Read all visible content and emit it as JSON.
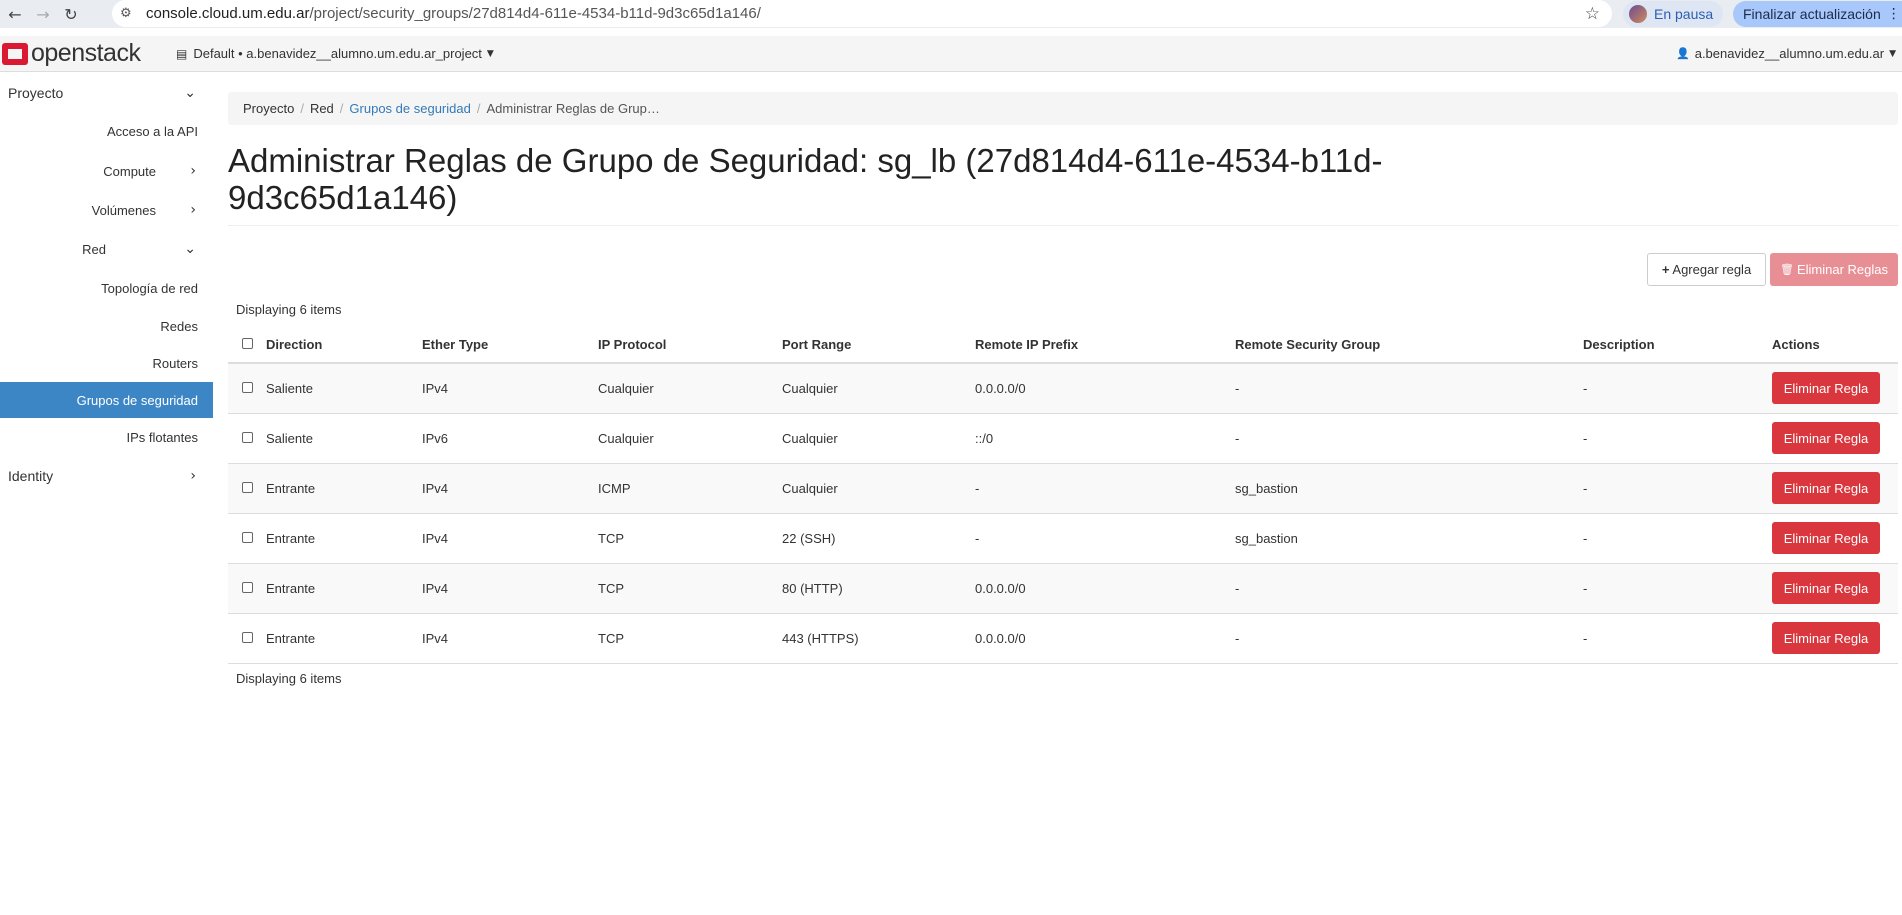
{
  "browser": {
    "url_host": "console.cloud.um.edu.ar",
    "url_path": "/project/security_groups/27d814d4-611e-4534-b11d-9d3c65d1a146/",
    "pause_label": "En pausa",
    "update_label": "Finalizar actualización"
  },
  "topnav": {
    "logo_text": "openstack",
    "project_label": "Default • a.benavidez__alumno.um.edu.ar_project",
    "user_label": "a.benavidez__alumno.um.edu.ar"
  },
  "sidebar": {
    "items": [
      {
        "label": "Proyecto"
      },
      {
        "label": "Acceso a la API"
      },
      {
        "label": "Compute"
      },
      {
        "label": "Volúmenes"
      },
      {
        "label": "Red"
      },
      {
        "label": "Topología de red"
      },
      {
        "label": "Redes"
      },
      {
        "label": "Routers"
      },
      {
        "label": "Grupos de seguridad"
      },
      {
        "label": "IPs flotantes"
      },
      {
        "label": "Identity"
      }
    ]
  },
  "breadcrumb": [
    "Proyecto",
    "Red",
    "Grupos de seguridad",
    "Administrar Reglas de Grup…"
  ],
  "page": {
    "title": "Administrar Reglas de Grupo de Seguridad: sg_lb (27d814d4-611e-4534-b11d-9d3c65d1a146)",
    "add_button": "Agregar regla",
    "delete_all_button": "Eliminar Reglas",
    "count_label": "Displaying 6 items"
  },
  "table": {
    "columns": [
      "Direction",
      "Ether Type",
      "IP Protocol",
      "Port Range",
      "Remote IP Prefix",
      "Remote Security Group",
      "Description",
      "Actions"
    ],
    "action_label": "Eliminar Regla",
    "rows": [
      [
        "Saliente",
        "IPv4",
        "Cualquier",
        "Cualquier",
        "0.0.0.0/0",
        "-",
        "-"
      ],
      [
        "Saliente",
        "IPv6",
        "Cualquier",
        "Cualquier",
        "::/0",
        "-",
        "-"
      ],
      [
        "Entrante",
        "IPv4",
        "ICMP",
        "Cualquier",
        "-",
        "sg_bastion",
        "-"
      ],
      [
        "Entrante",
        "IPv4",
        "TCP",
        "22 (SSH)",
        "-",
        "sg_bastion",
        "-"
      ],
      [
        "Entrante",
        "IPv4",
        "TCP",
        "80 (HTTP)",
        "0.0.0.0/0",
        "-",
        "-"
      ],
      [
        "Entrante",
        "IPv4",
        "TCP",
        "443 (HTTPS)",
        "0.0.0.0/0",
        "-",
        "-"
      ]
    ]
  },
  "colors": {
    "active_nav": "#3d86c6",
    "danger": "#d9363e",
    "link": "#337ab7"
  }
}
